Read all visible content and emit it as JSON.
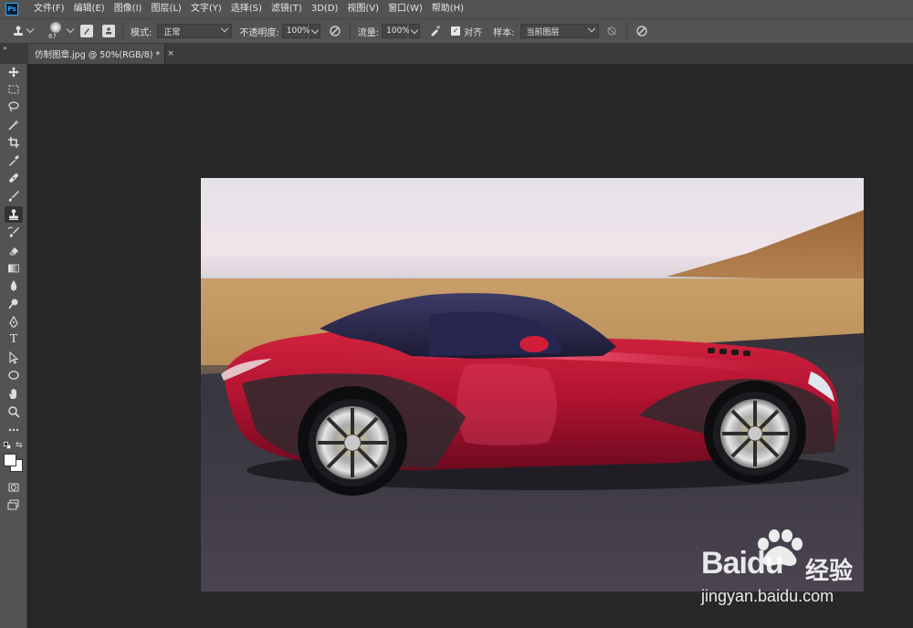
{
  "app": {
    "logo_text": "Ps"
  },
  "menu": [
    "文件(F)",
    "编辑(E)",
    "图像(I)",
    "图层(L)",
    "文字(Y)",
    "选择(S)",
    "滤镜(T)",
    "3D(D)",
    "视图(V)",
    "窗口(W)",
    "帮助(H)"
  ],
  "options": {
    "brush_size": "67",
    "mode_label": "模式:",
    "mode_value": "正常",
    "opacity_label": "不透明度:",
    "opacity_value": "100%",
    "flow_label": "流量:",
    "flow_value": "100%",
    "align_label": "对齐",
    "align_checked": true,
    "sample_label": "样本:",
    "sample_value": "当前图层"
  },
  "document": {
    "tab_title": "仿制图章.jpg @ 50%(RGB/8) *",
    "close_glyph": "×"
  },
  "toolbar": {
    "collapse_glyph": "»",
    "tools": [
      "move-tool",
      "marquee-tool",
      "lasso-tool",
      "magic-wand-tool",
      "crop-tool",
      "eyedropper-tool",
      "healing-brush-tool",
      "brush-tool",
      "clone-stamp-tool",
      "history-brush-tool",
      "eraser-tool",
      "gradient-tool",
      "blur-tool",
      "dodge-tool",
      "pen-tool",
      "type-tool",
      "path-selection-tool",
      "ellipse-tool",
      "hand-tool",
      "zoom-tool",
      "more-tools"
    ],
    "active_tool": "clone-stamp-tool",
    "type_glyph": "T"
  },
  "watermark": {
    "brand": "Bai",
    "brand2": "du",
    "cn_text": "经验",
    "url": "jingyan.baidu.com"
  },
  "colors": {
    "foreground": "#ffffff",
    "background": "#ffffff",
    "car_body": "#b0142f",
    "sky": "#e8e2ea",
    "sand": "#c9a06a",
    "road": "#3a3640"
  }
}
